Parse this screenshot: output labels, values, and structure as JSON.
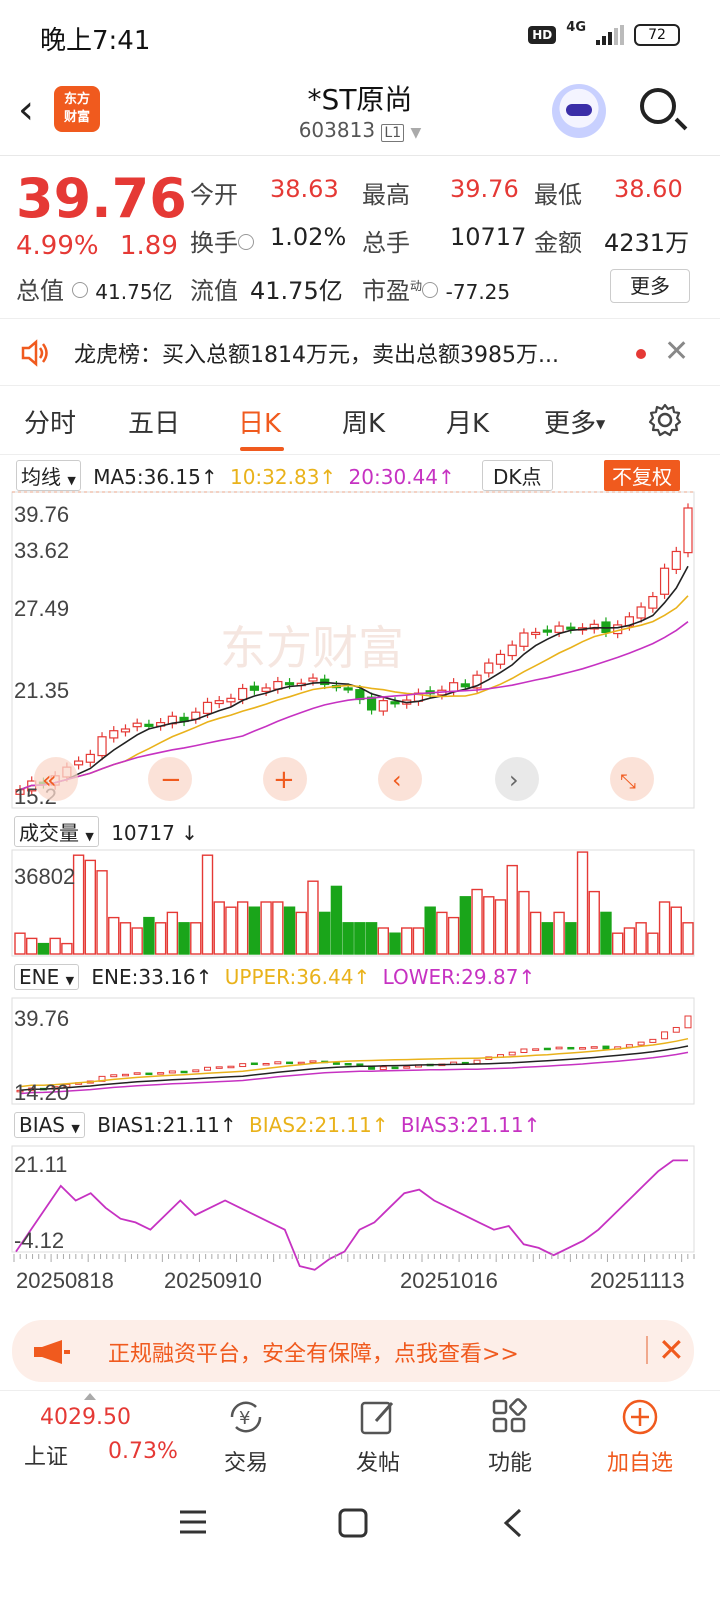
{
  "status": {
    "time": "晚上7:41",
    "hd": "HD",
    "network": "4G",
    "battery": "72"
  },
  "header": {
    "logo_line1": "东方",
    "logo_line2": "财富",
    "stock_name": "*ST原尚",
    "stock_code": "603813",
    "code_badge": "L1"
  },
  "quote": {
    "price": "39.76",
    "change_pct": "4.99%",
    "change_amt": "1.89",
    "total_cap_label": "总值",
    "total_cap": "41.75亿",
    "open_label": "今开",
    "open": "38.63",
    "high_label": "最高",
    "high": "39.76",
    "low_label": "最低",
    "low": "38.60",
    "turnover_label": "换手",
    "turnover": "1.02%",
    "volume_label": "总手",
    "volume": "10717",
    "amount_label": "金额",
    "amount": "4231万",
    "float_cap_label": "流值",
    "float_cap": "41.75亿",
    "pe_label": "市盈",
    "pe_sup": "动",
    "pe": "-77.25",
    "more_label": "更多"
  },
  "notice": {
    "text": "龙虎榜：买入总额1814万元，卖出总额3985万..."
  },
  "tabs": [
    "分时",
    "五日",
    "日K",
    "周K",
    "月K",
    "更多"
  ],
  "active_tab": "日K",
  "ma_bar": {
    "dropdown": "均线",
    "ma5": "MA5:36.15",
    "ma10": "10:32.83",
    "ma20": "20:30.44",
    "dk_label": "DK点",
    "nofq_label": "不复权"
  },
  "vol_bar": {
    "dropdown": "成交量",
    "value": "10717"
  },
  "ene_bar": {
    "dropdown": "ENE",
    "ene": "ENE:33.16",
    "upper": "UPPER:36.44",
    "lower": "LOWER:29.87"
  },
  "bias_bar": {
    "dropdown": "BIAS",
    "bias1": "BIAS1:21.11",
    "bias2": "BIAS2:21.11",
    "bias3": "BIAS3:21.11"
  },
  "chart_data": {
    "type": "candlestick",
    "price_axis_labels": [
      "39.76",
      "33.62",
      "27.49",
      "21.35",
      "15.2"
    ],
    "volume_axis_label": "36802",
    "ene_axis_labels": [
      "39.76",
      "14.20"
    ],
    "bias_axis_labels": [
      "21.11",
      "-4.12"
    ],
    "date_labels": [
      "20250818",
      "20250910",
      "20251016",
      "20251113"
    ],
    "watermark": "东方财富"
  },
  "colors": {
    "up": "#e53935",
    "down": "#1aa51a",
    "accent": "#f05a1e",
    "ma5": "#222222",
    "ma10": "#e9b21b",
    "ma20": "#c632c2"
  },
  "promo": {
    "text": "正规融资平台，安全有保障，点我查看>>"
  },
  "bottom_nav": {
    "index_value": "4029.50",
    "index_name": "上证",
    "index_pct": "0.73%",
    "items": [
      "交易",
      "发帖",
      "功能",
      "加自选"
    ]
  }
}
